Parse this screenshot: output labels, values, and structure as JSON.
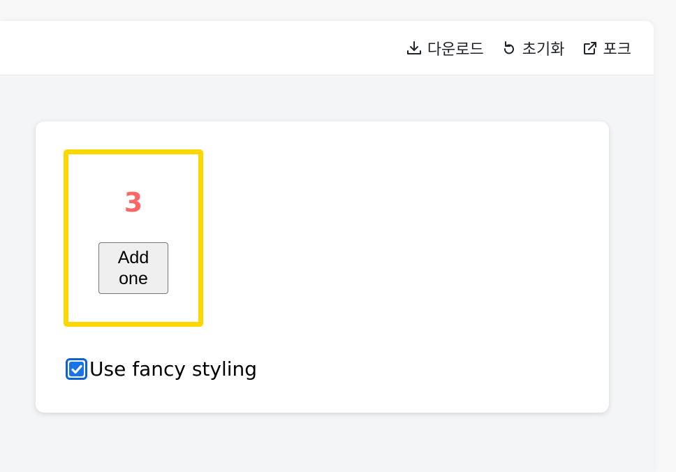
{
  "toolbar": {
    "download_label": "다운로드",
    "reset_label": "초기화",
    "fork_label": "포크"
  },
  "counter": {
    "value": "3",
    "button_label": "Add one",
    "border_color": "#ffd700",
    "value_color": "#ff6666"
  },
  "fancy": {
    "label": "Use fancy styling",
    "checked": true
  },
  "icons": {
    "download": "download-icon",
    "reset": "reset-icon",
    "fork": "external-link-icon",
    "check": "check-icon"
  }
}
